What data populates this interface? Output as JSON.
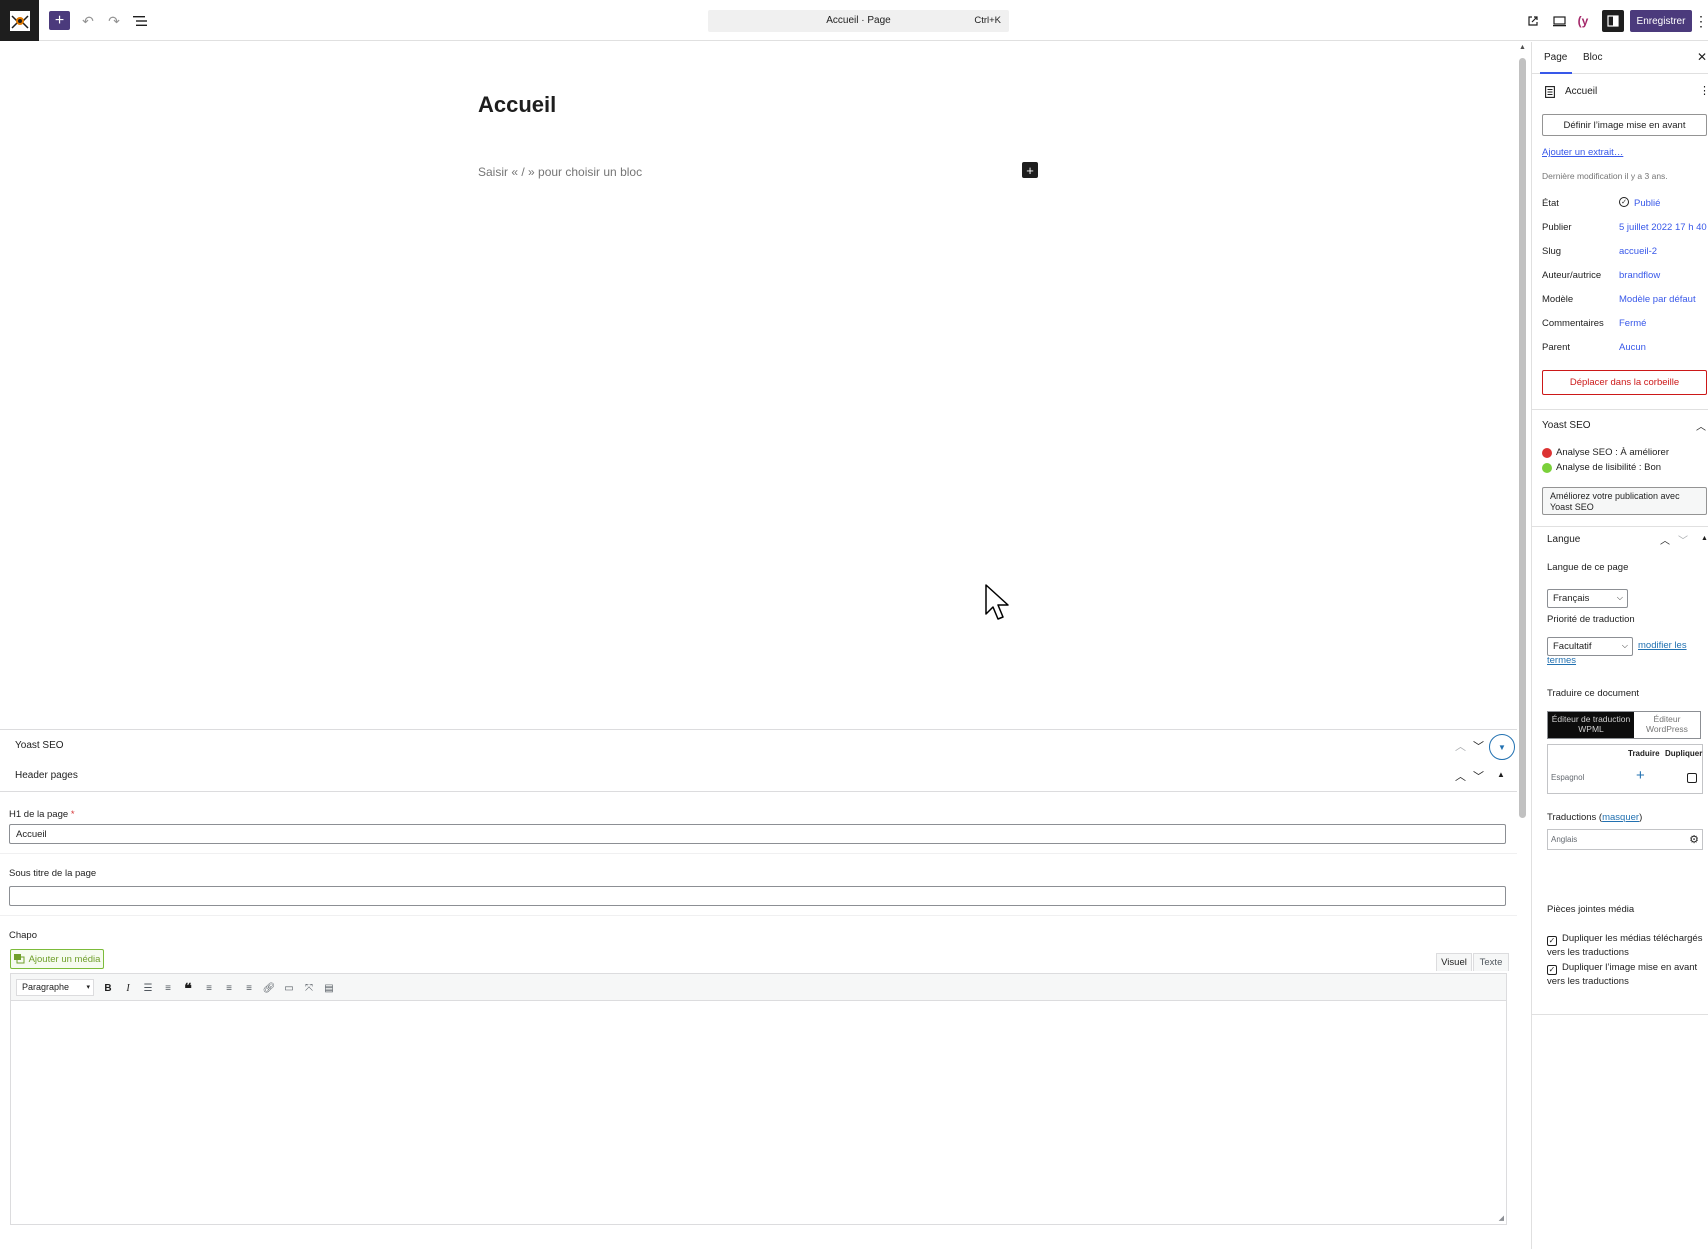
{
  "toolbar": {
    "command_title": "Accueil · Page",
    "command_shortcut": "Ctrl+K",
    "save_label": "Enregistrer",
    "add_icon": "plus-icon",
    "undo_icon": "undo-icon",
    "redo_icon": "redo-icon",
    "list_view_icon": "list-view-icon",
    "view_icon": "external-link-icon",
    "device_icon": "desktop-icon",
    "yoast_icon": "yoast-icon",
    "settings_icon": "sidebar-toggle-icon",
    "more_icon": "more-vertical-icon",
    "accent_color": "#4b3a7c"
  },
  "editor": {
    "title": "Accueil",
    "placeholder": "Saisir « / » pour choisir un bloc"
  },
  "metaboxes": {
    "yoast_title": "Yoast SEO",
    "header_pages_title": "Header pages",
    "h1_label": "H1 de la page",
    "h1_required": "*",
    "h1_value": "Accueil",
    "subtitle_label": "Sous titre de la page",
    "subtitle_value": "",
    "chapo_label": "Chapo",
    "add_media_label": "Ajouter un média",
    "tab_visual": "Visuel",
    "tab_text": "Texte",
    "format_select": "Paragraphe"
  },
  "sidebar": {
    "tab_page": "Page",
    "tab_block": "Bloc",
    "doc_title": "Accueil",
    "featured_image_button": "Définir l’image mise en avant",
    "excerpt_link": "Ajouter un extrait…",
    "last_modified": "Dernière modification il y a 3 ans.",
    "rows": [
      {
        "label": "État",
        "value": "Publié"
      },
      {
        "label": "Publier",
        "value": "5 juillet 2022 17 h 40"
      },
      {
        "label": "Slug",
        "value": "accueil-2"
      },
      {
        "label": "Auteur/autrice",
        "value": "brandflow"
      },
      {
        "label": "Modèle",
        "value": "Modèle par défaut"
      },
      {
        "label": "Commentaires",
        "value": "Fermé"
      },
      {
        "label": "Parent",
        "value": "Aucun"
      }
    ],
    "trash_button": "Déplacer dans la corbeille",
    "yoast": {
      "title": "Yoast SEO",
      "seo_analysis": "Analyse SEO : À améliorer",
      "readability": "Analyse de lisibilité : Bon",
      "improve_button": "Améliorez votre publication avec Yoast SEO",
      "seo_color": "#dc3232",
      "readability_color": "#7ad03a"
    },
    "language": {
      "title": "Langue",
      "page_language_label": "Langue de ce page",
      "page_language_value": "Français",
      "priority_label": "Priorité de traduction",
      "priority_value": "Facultatif",
      "modify_terms_link_1": "modifier les",
      "modify_terms_link_2": "termes",
      "translate_doc_label": "Traduire ce document",
      "toggle_wpml": "Éditeur de traduction WPML",
      "toggle_wp": "Éditeur WordPress",
      "table_translate": "Traduire",
      "table_duplicate": "Dupliquer",
      "table_row_language": "Espagnol",
      "translations_label": "Traductions",
      "translations_hide": "masquer",
      "translations_lang": "Anglais",
      "media_title": "Pièces jointes média",
      "media_dup_uploaded": "Dupliquer les médias téléchargés vers les traductions",
      "media_dup_featured": "Dupliquer l’image mise en avant vers les traductions"
    }
  }
}
